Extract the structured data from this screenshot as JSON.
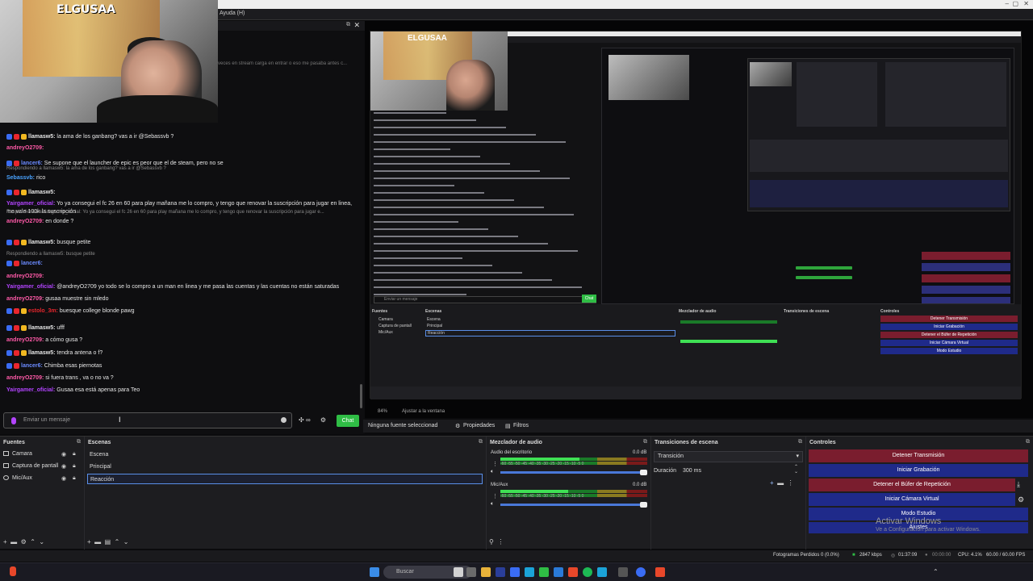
{
  "topbar": {
    "menu": "Ayuda (H)"
  },
  "window": {
    "minimize": "–",
    "maximize": "▢",
    "close": "✕"
  },
  "webcam": {
    "logo": "ELGUSAA"
  },
  "chat": {
    "pinned_fragment": "veces en stream carga en entrar o eso me pasaba antes c...",
    "messages": [
      {
        "user": "llamasw5:",
        "text": " la ama de los ganbang? vas a ir @Sebassvb ?",
        "color": "#e6e6e6",
        "badges": [
          "#3a6cf4",
          "#e9262d",
          "#f1b821"
        ]
      },
      {
        "user": "andreyO2709:",
        "text": "",
        "color": "#ff5aa8",
        "badges": []
      },
      {
        "user": "lancer6:",
        "text": " Se supone que el launcher de epic es peor que el de steam, pero no se",
        "color": "#6b8bff",
        "badges": [
          "#3a6cf4",
          "#e9262d"
        ]
      },
      {
        "user": "Sebassvb:",
        "text": " rico",
        "color": "#4aa3ff",
        "badges": [],
        "reply": "Respondiendo a llamasw5: la ama de los ganbang? vas a ir @Sebassvb ?"
      },
      {
        "user": "llamasw5:",
        "text": "",
        "color": "#e6e6e6",
        "badges": [
          "#3a6cf4",
          "#e9262d",
          "#f1b821"
        ]
      },
      {
        "user": "Yairgamer_oficial:",
        "text": " Yo ya consegui el fc 26 en 60 para play mañana me lo compro, y tengo que renovar la suscripción para jugar en linea, me vale 100k la suscripción",
        "color": "#b344ff",
        "badges": []
      },
      {
        "user": "andreyO2709:",
        "text": " en donde ?",
        "color": "#ff5aa8",
        "badges": [],
        "reply": "Respondiendo a Yairgamer_oficial: Yo ya consegui el fc 26 en 60 para play mañana me lo compro, y tengo que renovar la suscripción para jugar e..."
      },
      {
        "user": "llamasw5:",
        "text": " busque petite",
        "color": "#e6e6e6",
        "badges": [
          "#3a6cf4",
          "#e9262d",
          "#f1b821"
        ]
      },
      {
        "user": "lancer6:",
        "text": "",
        "color": "#6b8bff",
        "badges": [
          "#3a6cf4",
          "#e9262d"
        ],
        "reply": "Respondiendo a llamasw5: busque petite"
      },
      {
        "user": "andreyO2709:",
        "text": "",
        "color": "#ff5aa8",
        "badges": []
      },
      {
        "user": "Yairgamer_oficial:",
        "text": " @andreyO2709 yo todo se lo compro a un man en linea y me pasa las cuentas y las cuentas no están saturadas",
        "color": "#b344ff",
        "badges": []
      },
      {
        "user": "andreyO2709:",
        "text": " gusaa muestre sin mledo",
        "color": "#ff5aa8",
        "badges": []
      },
      {
        "user": "estolo_3m:",
        "text": " buesque college blonde pawg",
        "color": "#e9262d",
        "badges": [
          "#3a6cf4",
          "#e9262d",
          "#f1b821"
        ]
      },
      {
        "user": "llamasw5:",
        "text": " ufff",
        "color": "#e6e6e6",
        "badges": [
          "#3a6cf4",
          "#e9262d",
          "#f1b821"
        ]
      },
      {
        "user": "andreyO2709:",
        "text": " a cómo gusa ?",
        "color": "#ff5aa8",
        "badges": []
      },
      {
        "user": "llamasw5:",
        "text": " tendra antena o f?",
        "color": "#e6e6e6",
        "badges": [
          "#3a6cf4",
          "#e9262d",
          "#f1b821"
        ]
      },
      {
        "user": "lancer6:",
        "text": " Chimba esas piernotas",
        "color": "#6b8bff",
        "badges": [
          "#3a6cf4",
          "#e9262d"
        ]
      },
      {
        "user": "andreyO2709:",
        "text": " si fuera trans , va o no va ?",
        "color": "#ff5aa8",
        "badges": []
      },
      {
        "user": "Yairgamer_oficial:",
        "text": " Gusaa esa está apenas para Teo",
        "color": "#b344ff",
        "badges": []
      }
    ],
    "input_placeholder": "Enviar un mensaje",
    "chat_button": "Chat"
  },
  "nested": {
    "logo": "ELGUSAA",
    "placeholder": "Enviar un mensaje",
    "chat": "Chat"
  },
  "preview_bar": {
    "zoom": "84%",
    "fit": "Ajustar a la ventana"
  },
  "properties_bar": {
    "no_source": "Ninguna fuente seleccionad",
    "properties": "Propiedades",
    "filters": "Filtros"
  },
  "docks": {
    "sources": {
      "title": "Fuentes",
      "items": [
        "Camara",
        "Captura de pantall",
        "Mic/Aux"
      ]
    },
    "scenes": {
      "title": "Escenas",
      "items": [
        "Escena",
        "Principal",
        "Reacción"
      ]
    },
    "mixer": {
      "title": "Mezclador de audio",
      "channels": [
        {
          "name": "Audio del escritorio",
          "db": "0.0 dB",
          "level": 0.82
        },
        {
          "name": "Mic/Aux",
          "db": "0.0 dB",
          "level": 0.7
        }
      ],
      "ticks": "-60 -55 -50 -45 -40 -35 -30 -25 -20 -15 -10  -5  0"
    },
    "transitions": {
      "title": "Transiciones de escena",
      "selected": "Transición",
      "duration_label": "Duración",
      "duration_value": "300 ms"
    },
    "controls": {
      "title": "Controles",
      "buttons": [
        "Detener Transmisión",
        "Iniciar Grabación",
        "Detener el Búfer de Repetición",
        "Iniciar Cámara Virtual",
        "Modo Estudio",
        "Ajustes"
      ],
      "watermark1": "Activar Windows",
      "watermark2": "Ve a Configuración para activar Windows."
    }
  },
  "status": {
    "dropped": "Fotogramas Perdidos 0 (0.0%)",
    "bitrate": "2847 kbps",
    "stream_time": "01:37:09",
    "rec_time": "00:00:00",
    "cpu": "CPU: 4.1%",
    "fps": "60.00 / 60.00 FPS"
  },
  "taskbar": {
    "search": "Buscar"
  }
}
